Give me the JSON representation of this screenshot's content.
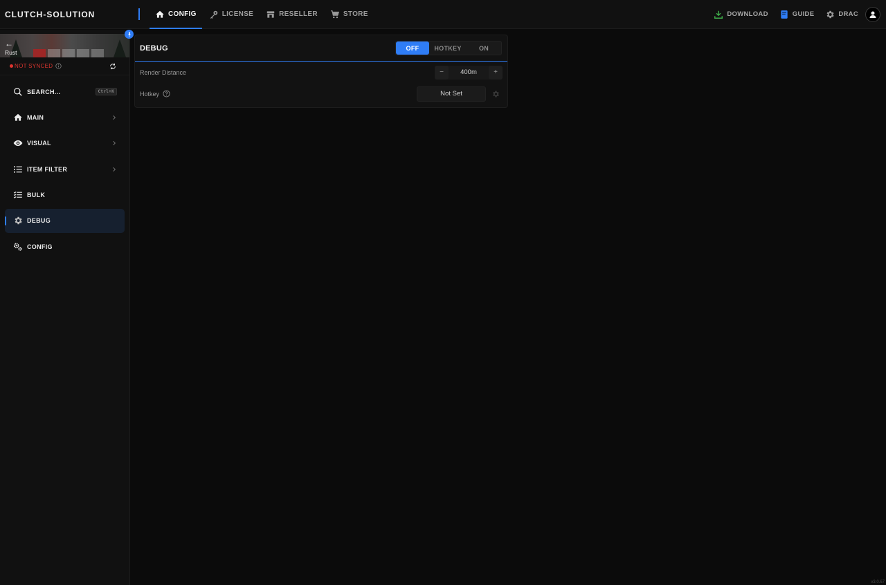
{
  "app": {
    "brand": "CLUTCH-SOLUTION",
    "version": "v3.0.67"
  },
  "topnav": {
    "tabs": [
      {
        "label": "CONFIG",
        "icon": "home-icon",
        "active": true
      },
      {
        "label": "LICENSE",
        "icon": "key-icon",
        "active": false
      },
      {
        "label": "RESELLER",
        "icon": "store-icon",
        "active": false
      },
      {
        "label": "STORE",
        "icon": "cart-icon",
        "active": false
      }
    ],
    "right": {
      "download": "DOWNLOAD",
      "guide": "GUIDE",
      "user": "DRAC"
    }
  },
  "sidebar": {
    "game": "Rust",
    "sync_status": "NOT SYNCED",
    "search": {
      "label": "SEARCH...",
      "shortcut": "Ctrl+K"
    },
    "items": [
      {
        "label": "MAIN",
        "icon": "home-icon",
        "has_children": true
      },
      {
        "label": "VISUAL",
        "icon": "eye-icon",
        "has_children": true
      },
      {
        "label": "ITEM FILTER",
        "icon": "list-icon",
        "has_children": true
      },
      {
        "label": "BULK",
        "icon": "checklist-icon",
        "has_children": false
      },
      {
        "label": "DEBUG",
        "icon": "gear-icon",
        "has_children": false,
        "active": true
      },
      {
        "label": "CONFIG",
        "icon": "gears-icon",
        "has_children": false
      }
    ]
  },
  "panel": {
    "title": "DEBUG",
    "mode_options": [
      "OFF",
      "HOTKEY",
      "ON"
    ],
    "mode_selected": "OFF",
    "render_distance": {
      "label": "Render Distance",
      "value": "400m",
      "minus": "−",
      "plus": "+"
    },
    "hotkey": {
      "label": "Hotkey",
      "value": "Not Set"
    }
  },
  "colors": {
    "accent": "#2f7df6",
    "danger": "#e0342f",
    "download": "#3fae4a"
  }
}
